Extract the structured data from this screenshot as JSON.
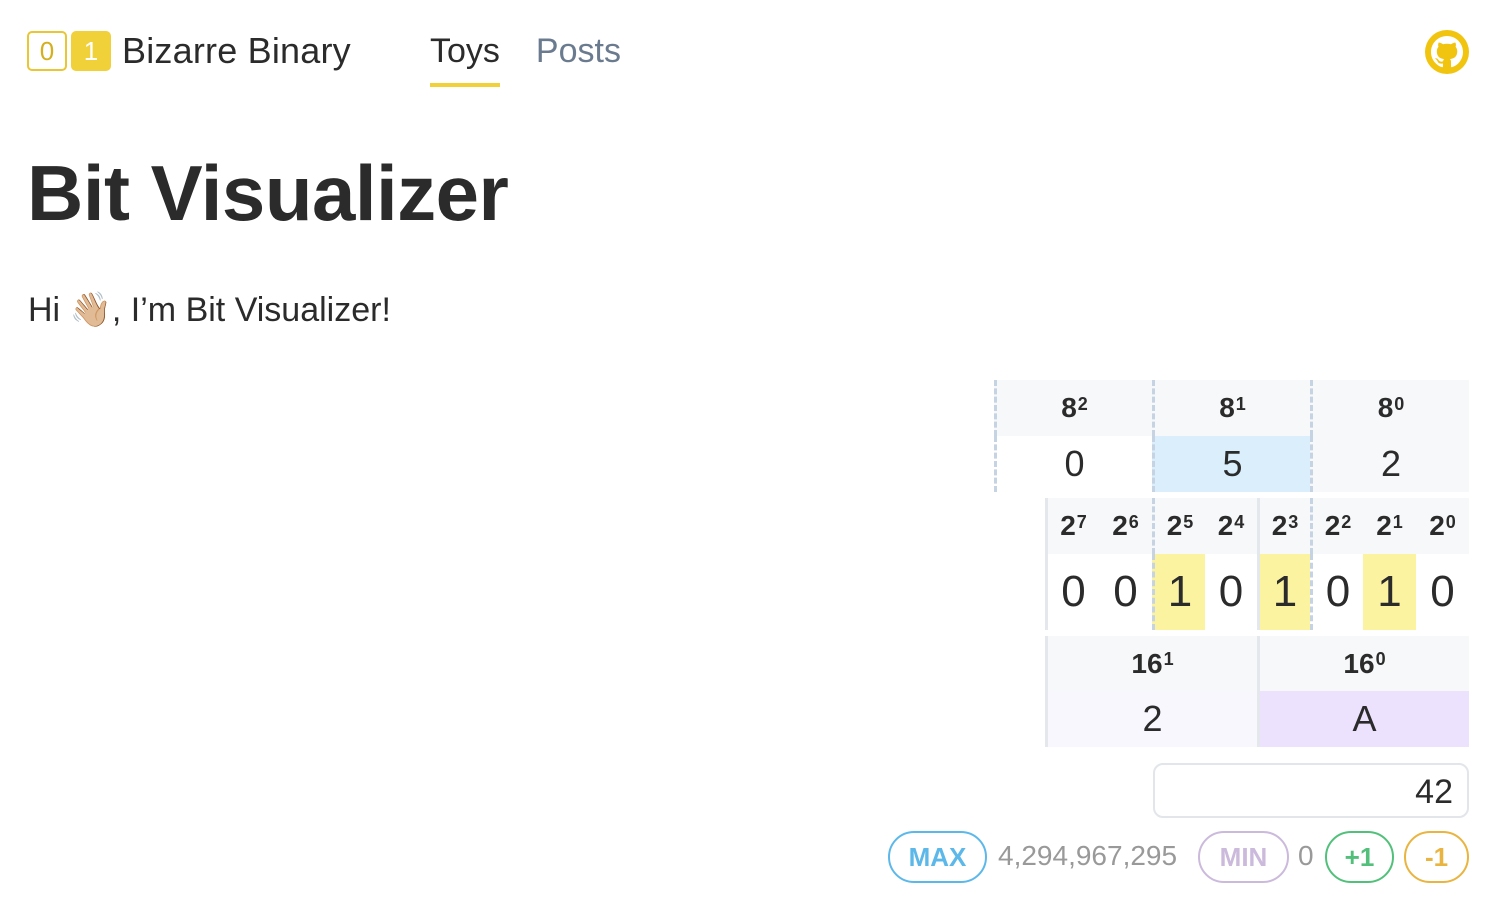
{
  "header": {
    "logo_bits": [
      "0",
      "1"
    ],
    "brand_name": "Bizarre Binary",
    "nav": [
      {
        "label": "Toys",
        "active": true
      },
      {
        "label": "Posts",
        "active": false
      }
    ],
    "github_icon": "github-icon"
  },
  "page": {
    "title": "Bit Visualizer",
    "greeting_pre": "Hi ",
    "greeting_emoji": "👋🏼",
    "greeting_post": ", I’m Bit Visualizer!"
  },
  "visualizer": {
    "octal": {
      "headers": [
        {
          "base": "8",
          "exp": "2"
        },
        {
          "base": "8",
          "exp": "1"
        },
        {
          "base": "8",
          "exp": "0"
        }
      ],
      "digits": [
        "0",
        "5",
        "2"
      ]
    },
    "binary": {
      "headers": [
        {
          "base": "2",
          "exp": "7"
        },
        {
          "base": "2",
          "exp": "6"
        },
        {
          "base": "2",
          "exp": "5"
        },
        {
          "base": "2",
          "exp": "4"
        },
        {
          "base": "2",
          "exp": "3"
        },
        {
          "base": "2",
          "exp": "2"
        },
        {
          "base": "2",
          "exp": "1"
        },
        {
          "base": "2",
          "exp": "0"
        }
      ],
      "bits": [
        "0",
        "0",
        "1",
        "0",
        "1",
        "0",
        "1",
        "0"
      ]
    },
    "hex": {
      "headers": [
        {
          "base": "16",
          "exp": "1"
        },
        {
          "base": "16",
          "exp": "0"
        }
      ],
      "digits": [
        "2",
        "A"
      ]
    },
    "input_value": "42",
    "controls": {
      "max_label": "MAX",
      "max_value": "4,294,967,295",
      "min_label": "MIN",
      "min_value": "0",
      "increment_label": "+1",
      "decrement_label": "-1"
    }
  },
  "colors": {
    "accent_yellow": "#f1d13a",
    "octal_highlight": "#dbeefc",
    "bit_highlight": "#fbf3a0",
    "hex_highlight": "#ece2fd",
    "max_blue": "#5db8ea",
    "min_purple": "#cbbadc",
    "plus_green": "#52c07a",
    "minus_orange": "#e9b440"
  }
}
